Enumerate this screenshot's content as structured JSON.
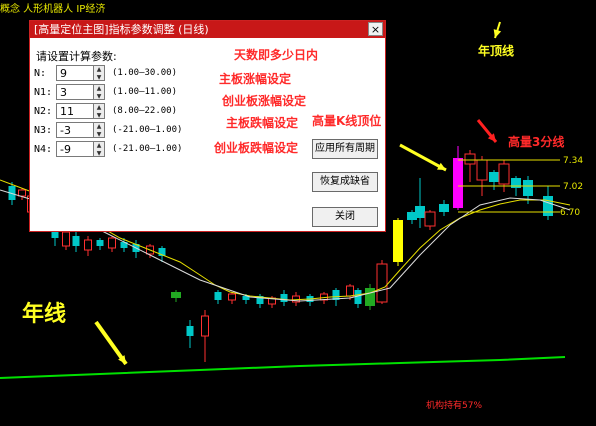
{
  "topbar": {
    "text": "概念 人形机器人 IP经济"
  },
  "dialog": {
    "title": "[高量定位主图]指标参数调整 (日线)",
    "close_glyph": "×",
    "prompt": "请设置计算参数:",
    "params": [
      {
        "label": "N:",
        "value": "9",
        "range": "(1.00—30.00)"
      },
      {
        "label": "N1:",
        "value": "3",
        "range": "(1.00—11.00)"
      },
      {
        "label": "N2:",
        "value": "11",
        "range": "(8.00—22.00)"
      },
      {
        "label": "N3:",
        "value": "-3",
        "range": "(-21.00—1.00)"
      },
      {
        "label": "N4:",
        "value": "-9",
        "range": "(-21.00—1.00)"
      }
    ],
    "buttons": {
      "apply_all": "应用所有周期",
      "restore": "恢复成缺省",
      "close": "关闭"
    }
  },
  "annotations": {
    "days": "天数即多少日内",
    "main_up": "主板涨幅设定",
    "gem_up": "创业板涨幅设定",
    "main_down": "主板跌幅设定",
    "gem_down": "创业板跌幅设定",
    "high_vol_top": "高量K线顶位",
    "high_vol_3": "高量3分线",
    "year_top": "年顶线",
    "year_line": "年线",
    "institution": "机构持有57%"
  },
  "price_labels": [
    "7.34",
    "7.02",
    "6.70"
  ],
  "colors": {
    "up": "#ff3030",
    "down": "#00c8c8",
    "ma": "#e8e000",
    "year": "#00e000",
    "highlight": "#ff00ff"
  }
}
